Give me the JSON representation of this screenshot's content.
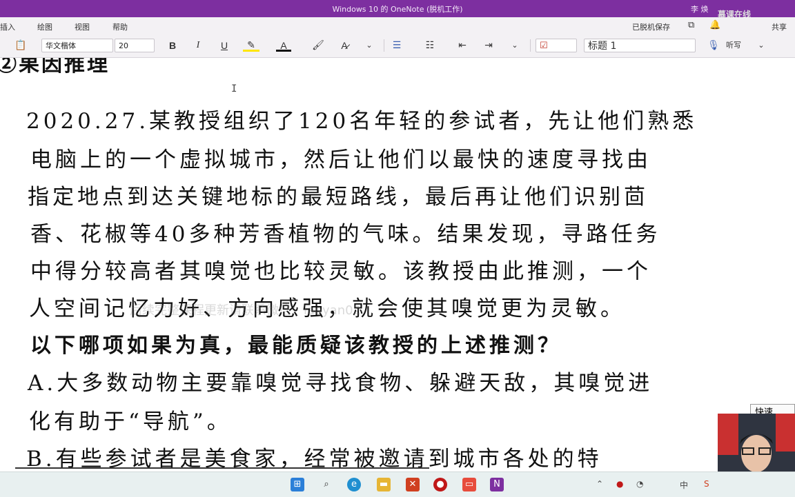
{
  "window": {
    "title": "Windows 10 的 OneNote (脱机工作)",
    "user": "李 焕"
  },
  "brand": {
    "watermark_logo": "慕课在线"
  },
  "menu": {
    "items": [
      "插入",
      "绘图",
      "视图",
      "帮助"
    ],
    "offline_save": "已脱机保存",
    "share": "共享"
  },
  "toolbar": {
    "font_name": "华文楷体",
    "font_size": "20",
    "bold": "B",
    "italic": "I",
    "underline": "U",
    "font_color": "A",
    "style": "标题 1",
    "dictate": "听写"
  },
  "note": {
    "heading": "②果因推理",
    "lines": [
      "2020.27.某教授组织了120名年轻的参试者，先让他们熟悉",
      "电脑上的一个虚拟城市，然后让他们以最快的速度寻找由",
      "指定地点到达关键地标的最短路线，最后再让他们识别茴",
      "香、花椒等40多种芳香植物的气味。结果发现，寻路任务",
      "中得分较高者其嗅觉也比较灵敏。该教授由此推测，一个",
      "人空间记忆力好、方向感强，就会使其嗅觉更为灵敏。"
    ],
    "question": "以下哪项如果为真，最能质疑该教授的上述推测？",
    "option_a_1": "A.大多数动物主要靠嗅觉寻找食物、躲避天敌，其嗅觉进",
    "option_a_2": "化有助于“导航”。",
    "option_b": "B.有些参试者是美食家，经常被邀请到城市各处的特"
  },
  "watermark": "后续完整课程更新请联系微信：laoyan02",
  "side_tab": "快速",
  "tray": {
    "ime": "中"
  }
}
